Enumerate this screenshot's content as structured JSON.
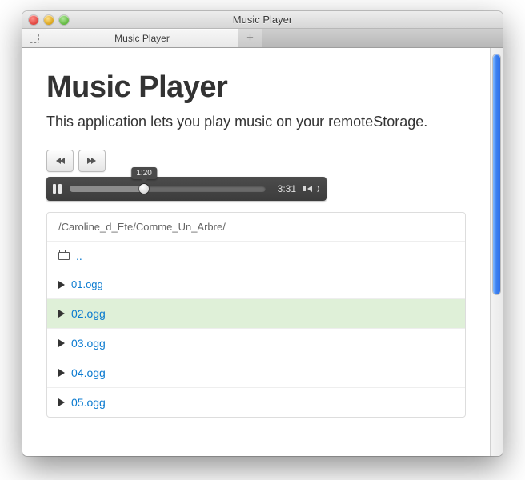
{
  "window": {
    "title": "Music Player"
  },
  "tab": {
    "label": "Music Player"
  },
  "heading": "Music Player",
  "subtitle": "This application lets you play music on your remoteStorage.",
  "player": {
    "current_time": "1:20",
    "duration": "3:31"
  },
  "path": "/Caroline_d_Ete/Comme_Un_Arbre/",
  "up_label": "..",
  "files": [
    {
      "name": "01.ogg",
      "active": false
    },
    {
      "name": "02.ogg",
      "active": true
    },
    {
      "name": "03.ogg",
      "active": false
    },
    {
      "name": "04.ogg",
      "active": false
    },
    {
      "name": "05.ogg",
      "active": false
    }
  ]
}
